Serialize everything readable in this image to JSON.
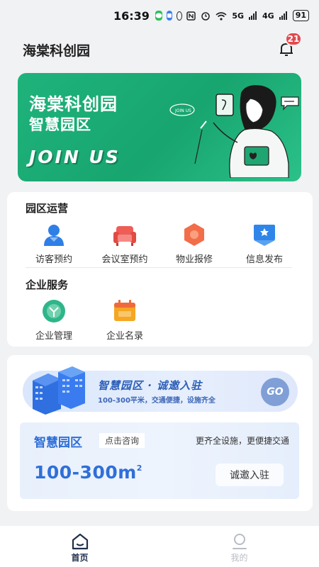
{
  "status_bar": {
    "time": "16:39",
    "battery": "91",
    "network_5g": "5G",
    "network_4g": "4G"
  },
  "header": {
    "title": "海棠科创园",
    "notification_count": "21"
  },
  "banner": {
    "title": "海棠科创园",
    "subtitle": "智慧园区",
    "tagline": "JOIN US",
    "art_caption": "JOIN US"
  },
  "park_ops": {
    "title": "园区运营",
    "items": [
      {
        "label": "访客预约",
        "icon": "visitor-icon",
        "color": "#2e7fe6"
      },
      {
        "label": "会议室预约",
        "icon": "sofa-icon",
        "color": "#ef5d57"
      },
      {
        "label": "物业报修",
        "icon": "repair-icon",
        "color": "#f26e4a"
      },
      {
        "label": "信息发布",
        "icon": "publish-icon",
        "color": "#2f86e8"
      }
    ]
  },
  "enterprise": {
    "title": "企业服务",
    "items": [
      {
        "label": "企业管理",
        "icon": "management-icon",
        "color": "#2fb58a"
      },
      {
        "label": "企业名录",
        "icon": "directory-icon",
        "color": "#f5a623"
      }
    ]
  },
  "promo": {
    "title": "智慧园区 · 诚邀入驻",
    "subtitle": "100-300平米，交通便捷，设施齐全",
    "go_label": "GO"
  },
  "info": {
    "title": "智慧园区",
    "consult": "点击咨询",
    "desc": "更齐全设施，更便捷交通",
    "range": "100-300m",
    "unit_sup": "2",
    "button": "诚邀入驻"
  },
  "nav": {
    "items": [
      {
        "label": "首页",
        "active": true
      },
      {
        "label": "我的",
        "active": false
      }
    ]
  },
  "colors": {
    "brand_green": "#1fb37c",
    "accent_blue": "#2f6fd8",
    "badge_red": "#e5484d"
  }
}
